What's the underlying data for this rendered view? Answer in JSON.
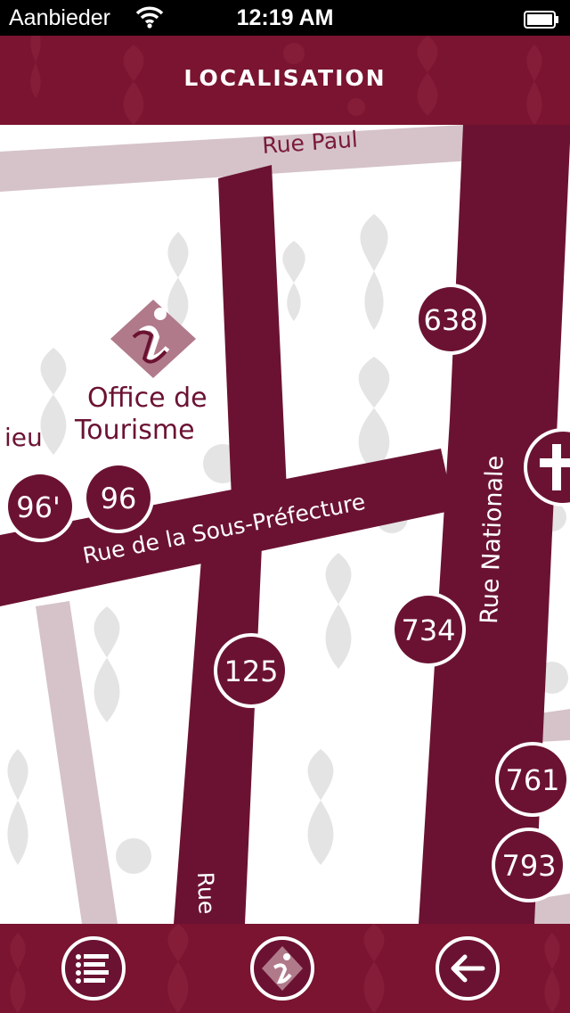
{
  "status_bar": {
    "carrier": "Aanbieder",
    "time": "12:19 AM"
  },
  "header": {
    "title": "LOCALISATION"
  },
  "map": {
    "streets": {
      "paul": "Rue Paul",
      "sous_prefecture": "Rue de la Sous-Préfecture",
      "nationale": "Rue Nationale",
      "lieu_partial": "ieu",
      "bottom_partial": "Rue"
    },
    "poi": {
      "office_line1": "Office de",
      "office_line2": "Tourisme"
    },
    "markers": [
      "638",
      "96'",
      "96",
      "734",
      "125",
      "761",
      "793"
    ]
  },
  "toolbar": {
    "menu": "menu",
    "info": "info",
    "back": "back"
  },
  "colors": {
    "brand": "#6b1232",
    "street": "#6b1232",
    "side_street": "#d5c3c9",
    "pattern": "#e4e4e4"
  }
}
